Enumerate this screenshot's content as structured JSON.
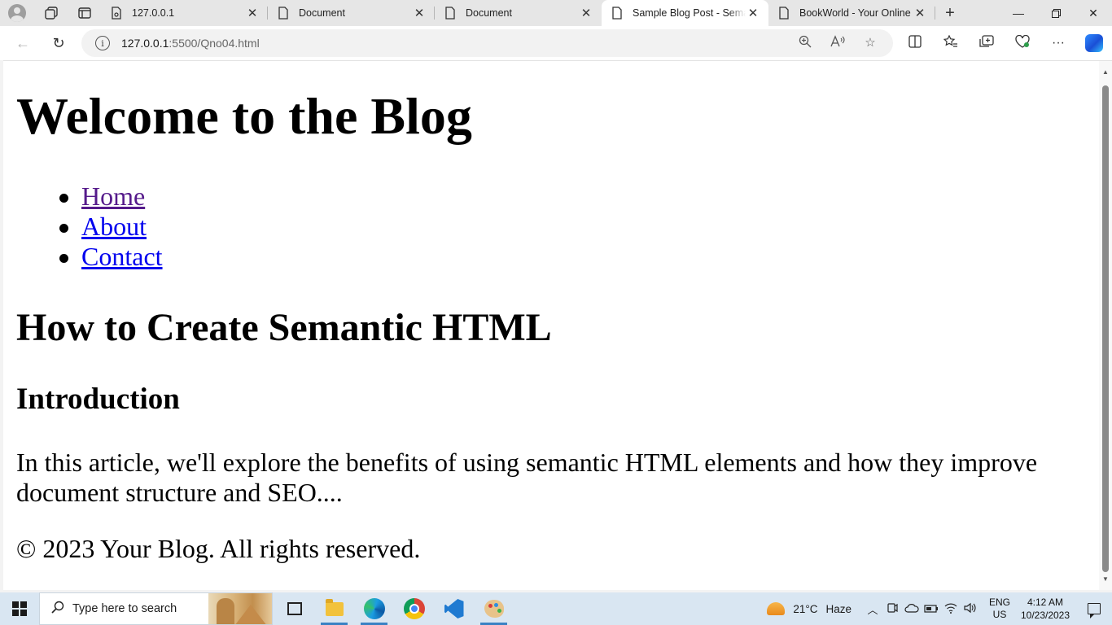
{
  "browser": {
    "tabs": [
      {
        "title": "127.0.0.1",
        "favicon": "broadcast-page-icon",
        "active": false
      },
      {
        "title": "Document",
        "favicon": "page-icon",
        "active": false
      },
      {
        "title": "Document",
        "favicon": "page-icon",
        "active": false
      },
      {
        "title": "Sample Blog Post - Semantic HTML",
        "favicon": "page-icon",
        "active": true
      },
      {
        "title": "BookWorld - Your Online Bookstore",
        "favicon": "page-icon",
        "active": false
      }
    ],
    "address": {
      "host": "127.0.0.1",
      "path": ":5500/Qno04.html"
    }
  },
  "page": {
    "heading": "Welcome to the Blog",
    "nav": [
      {
        "label": "Home",
        "visited": true
      },
      {
        "label": "About",
        "visited": false
      },
      {
        "label": "Contact",
        "visited": false
      }
    ],
    "article_title": "How to Create Semantic HTML",
    "section_title": "Introduction",
    "article_text": "In this article, we'll explore the benefits of using semantic HTML elements and how they improve document structure and SEO....",
    "footer": "© 2023 Your Blog. All rights reserved."
  },
  "colors": {
    "link": "#0000ee",
    "visited_link": "#551a8b",
    "taskbar": "#d9e6f2"
  },
  "taskbar": {
    "search_placeholder": "Type here to search",
    "apps": [
      "task-view-icon",
      "file-explorer-icon",
      "edge-icon",
      "chrome-icon",
      "vscode-icon",
      "paint-icon"
    ],
    "weather": {
      "temp": "21°C",
      "condition": "Haze"
    },
    "language": {
      "line1": "ENG",
      "line2": "US"
    },
    "clock": {
      "time": "4:12 AM",
      "date": "10/23/2023"
    }
  }
}
